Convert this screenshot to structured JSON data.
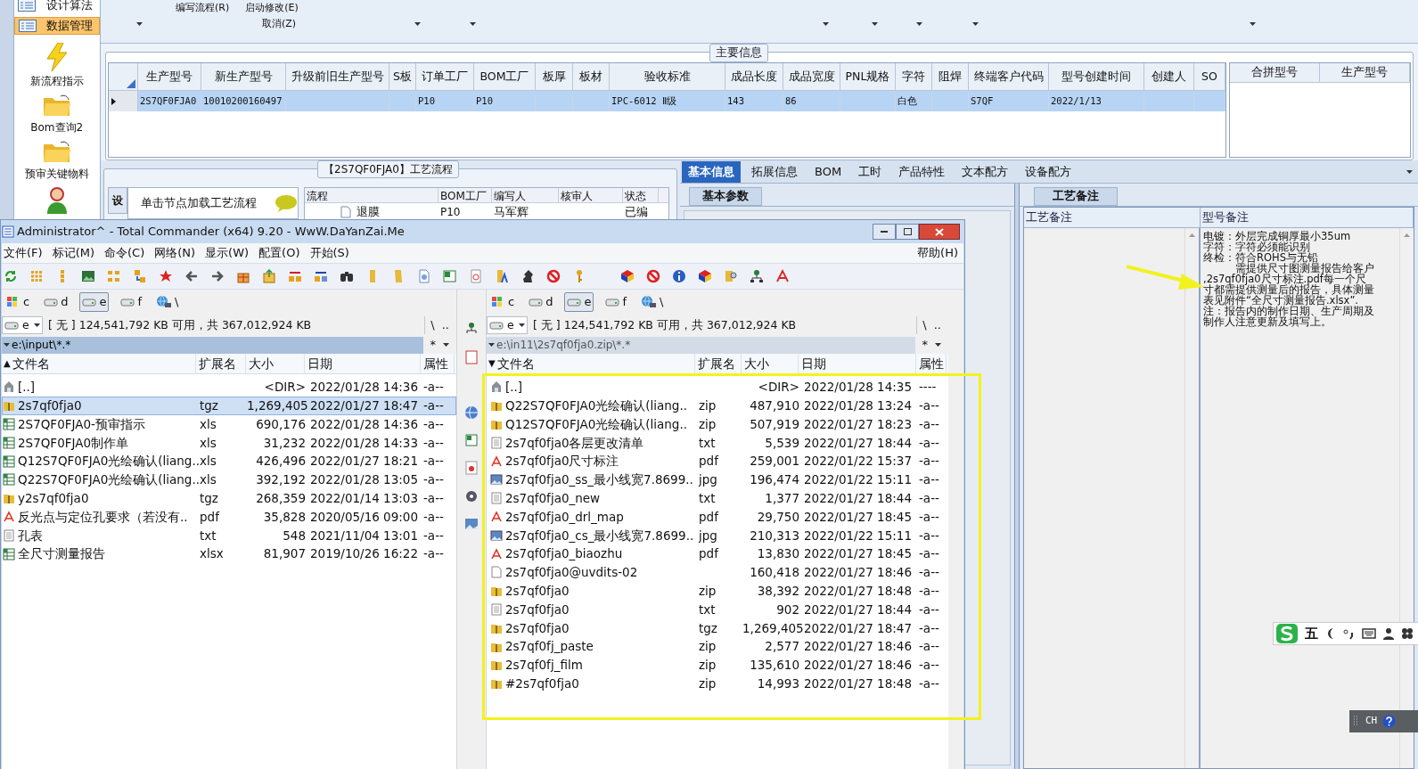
{
  "sidebar": {
    "items": [
      {
        "kind": "row",
        "label": "设计算法",
        "selected": false
      },
      {
        "kind": "row",
        "label": "数据管理",
        "selected": true
      },
      {
        "kind": "tile",
        "label": "新流程指示",
        "selected": false
      },
      {
        "kind": "tile",
        "label": "Bom查询2",
        "selected": false
      },
      {
        "kind": "tile",
        "label": "预审关键物料",
        "selected": false
      },
      {
        "kind": "tile",
        "selected": false
      }
    ]
  },
  "toolbar": {
    "commands": [
      "编写流程(R)",
      "启动修改(E)",
      "取消(Z)"
    ]
  },
  "main_info": {
    "title": "主要信息",
    "row_selected": true,
    "columns": [
      {
        "label": "生产型号",
        "value": "2S7QF0FJA0"
      },
      {
        "label": "新生产型号",
        "value": "10010200160497"
      },
      {
        "label": "升级前旧生产型号"
      },
      {
        "label": "S板"
      },
      {
        "label": "订单工厂",
        "value": "P10"
      },
      {
        "label": "BOM工厂",
        "value": "P10"
      },
      {
        "label": "板厚"
      },
      {
        "label": "板材"
      },
      {
        "label": "验收标准",
        "value": "IPC-6012 Ⅱ级"
      },
      {
        "label": "成品长度",
        "value": "143"
      },
      {
        "label": "成品宽度",
        "value": "86"
      },
      {
        "label": "PNL规格"
      },
      {
        "label": "字符",
        "value": "白色"
      },
      {
        "label": "阻焊"
      },
      {
        "label": "终端客户代码",
        "value": "S7QF"
      },
      {
        "label": "型号创建时间",
        "value": "2022/1/13"
      },
      {
        "label": "创建人"
      },
      {
        "label": "SO"
      }
    ],
    "merge_columns": [
      "合拼型号",
      "生产型号"
    ]
  },
  "process": {
    "title": "【2S7QF0FJA0】工艺流程",
    "side_tab": "设",
    "hint": "单击节点加载工艺流程",
    "columns": [
      "流程",
      "BOM工厂",
      "编写人",
      "核审人",
      "状态"
    ],
    "row": {
      "flow": "退膜",
      "bom": "P10",
      "writer": "马军辉",
      "status": "已编"
    }
  },
  "detail": {
    "tabs": [
      {
        "label": "基本信息",
        "selected": true
      },
      {
        "label": "拓展信息",
        "selected": false
      },
      {
        "label": "BOM",
        "selected": false
      },
      {
        "label": "工时",
        "selected": false
      },
      {
        "label": "产品特性",
        "selected": false
      },
      {
        "label": "文本配方",
        "selected": false
      },
      {
        "label": "设备配方",
        "selected": false
      }
    ],
    "sub_tab": "基本参数",
    "notes_tab": "工艺备注",
    "notes_columns": [
      "工艺备注",
      "型号备注"
    ],
    "model_note": [
      "电镀：外层完成铜厚最小35um",
      "字符：字符必须能识别",
      "终检：符合ROHS与无铅",
      "　　　需提供尺寸图测量报告给客户",
      ",2s7qf0fja0尺寸标注.pdf每一个尺",
      "寸都需提供测量后的报告，具体测量",
      "表见附件“全尺寸测量报告.xlsx”.",
      "注：报告内的制作日期、生产周期及",
      "制作人注意更新及填写上。"
    ]
  },
  "ime": {
    "mode": "五"
  },
  "language_bar": {
    "label": "CH"
  },
  "commander": {
    "title": "Administrator^ - Total Commander (x64) 9.20 - WwW.DaYanZai.Me",
    "menu": [
      "文件(F)",
      "标记(M)",
      "命令(C)",
      "网络(N)",
      "显示(W)",
      "配置(O)",
      "开始(S)"
    ],
    "help": "帮助(H)",
    "panels": [
      {
        "active": true,
        "sort": "▲",
        "drive": "e",
        "free_space": "[ 无 ] 124,541,792 KB 可用，共 367,012,924 KB",
        "root": "\\",
        "parent": "..",
        "path": "e:\\input\\*.*",
        "filter": "*",
        "drives": [
          {
            "kind": "system",
            "label": "c",
            "selected": false
          },
          {
            "kind": "disk",
            "label": "d",
            "selected": false
          },
          {
            "kind": "disk",
            "label": "e",
            "selected": true
          },
          {
            "kind": "disk",
            "label": "f",
            "selected": false
          },
          {
            "kind": "network",
            "label": "\\",
            "selected": false
          }
        ],
        "columns": [
          "文件名",
          "扩展名",
          "大小",
          "日期",
          "属性"
        ],
        "files": [
          {
            "kind": "up",
            "name": "[..]",
            "size": "<DIR>",
            "date": "2022/01/28 14:36",
            "attr": "-a--",
            "selected": false
          },
          {
            "kind": "archive",
            "name": "2s7qf0fja0",
            "ext": "tgz",
            "size": "1,269,405",
            "date": "2022/01/27 18:47",
            "attr": "-a--",
            "selected": true
          },
          {
            "kind": "sheet",
            "name": "2S7QF0FJA0-预审指示",
            "ext": "xls",
            "size": "690,176",
            "date": "2022/01/28 14:36",
            "attr": "-a--",
            "selected": false
          },
          {
            "kind": "sheet",
            "name": "2S7QF0FJA0制作单",
            "ext": "xls",
            "size": "31,232",
            "date": "2022/01/28 14:33",
            "attr": "-a--",
            "selected": false
          },
          {
            "kind": "sheet",
            "name": "Q12S7QF0FJA0光绘确认(liang..",
            "ext": "xls",
            "size": "426,496",
            "date": "2022/01/27 18:21",
            "attr": "-a--",
            "selected": false
          },
          {
            "kind": "sheet",
            "name": "Q22S7QF0FJA0光绘确认(liang..",
            "ext": "xls",
            "size": "392,192",
            "date": "2022/01/28 13:05",
            "attr": "-a--",
            "selected": false
          },
          {
            "kind": "archive",
            "name": "y2s7qf0fja0",
            "ext": "tgz",
            "size": "268,359",
            "date": "2022/01/14 13:03",
            "attr": "-a--",
            "selected": false
          },
          {
            "kind": "pdf",
            "name": "反光点与定位孔要求（若没有..",
            "ext": "pdf",
            "size": "35,828",
            "date": "2020/05/16 09:00",
            "attr": "-a--",
            "selected": false
          },
          {
            "kind": "text",
            "name": "孔表",
            "ext": "txt",
            "size": "548",
            "date": "2021/11/04 13:01",
            "attr": "-a--",
            "selected": false
          },
          {
            "kind": "sheet",
            "name": "全尺寸测量报告",
            "ext": "xlsx",
            "size": "81,907",
            "date": "2019/10/26 16:22",
            "attr": "-a--",
            "selected": false
          }
        ]
      },
      {
        "active": false,
        "sort": "▼",
        "drive": "e",
        "free_space": "[ 无 ] 124,541,792 KB 可用，共 367,012,924 KB",
        "root": "\\",
        "parent": "..",
        "path": "e:\\in11\\2s7qf0fja0.zip\\*.*",
        "filter": "*",
        "drives": [
          {
            "kind": "system",
            "label": "c",
            "selected": false
          },
          {
            "kind": "disk",
            "label": "d",
            "selected": false
          },
          {
            "kind": "disk",
            "label": "e",
            "selected": true
          },
          {
            "kind": "disk",
            "label": "f",
            "selected": false
          },
          {
            "kind": "network",
            "label": "\\",
            "selected": false
          }
        ],
        "columns": [
          "文件名",
          "扩展名",
          "大小",
          "日期",
          "属性"
        ],
        "files": [
          {
            "kind": "up",
            "name": "[..]",
            "size": "<DIR>",
            "date": "2022/01/28 14:35",
            "attr": "----",
            "selected": false
          },
          {
            "kind": "archive",
            "name": "Q22S7QF0FJA0光绘确认(liang..",
            "ext": "zip",
            "size": "487,910",
            "date": "2022/01/28 13:24",
            "attr": "-a--",
            "selected": false
          },
          {
            "kind": "archive",
            "name": "Q12S7QF0FJA0光绘确认(liang..",
            "ext": "zip",
            "size": "507,919",
            "date": "2022/01/27 18:23",
            "attr": "-a--",
            "selected": false
          },
          {
            "kind": "text",
            "name": "2s7qf0fja0各层更改清单",
            "ext": "txt",
            "size": "5,539",
            "date": "2022/01/27 18:44",
            "attr": "-a--",
            "selected": false
          },
          {
            "kind": "pdf",
            "name": "2s7qf0fja0尺寸标注",
            "ext": "pdf",
            "size": "259,001",
            "date": "2022/01/22 15:37",
            "attr": "-a--",
            "selected": false
          },
          {
            "kind": "image",
            "name": "2s7qf0fja0_ss_最小线宽7.8699..",
            "ext": "jpg",
            "size": "196,474",
            "date": "2022/01/22 15:11",
            "attr": "-a--",
            "selected": false
          },
          {
            "kind": "text",
            "name": "2s7qf0fja0_new",
            "ext": "txt",
            "size": "1,377",
            "date": "2022/01/27 18:44",
            "attr": "-a--",
            "selected": false
          },
          {
            "kind": "pdf",
            "name": "2s7qf0fja0_drl_map",
            "ext": "pdf",
            "size": "29,750",
            "date": "2022/01/27 18:45",
            "attr": "-a--",
            "selected": false
          },
          {
            "kind": "image",
            "name": "2s7qf0fja0_cs_最小线宽7.8699..",
            "ext": "jpg",
            "size": "210,313",
            "date": "2022/01/22 15:11",
            "attr": "-a--",
            "selected": false
          },
          {
            "kind": "pdf",
            "name": "2s7qf0fja0_biaozhu",
            "ext": "pdf",
            "size": "13,830",
            "date": "2022/01/27 18:45",
            "attr": "-a--",
            "selected": false
          },
          {
            "kind": "file",
            "name": "2s7qf0fja0@uvdits-02",
            "size": "160,418",
            "date": "2022/01/27 18:46",
            "attr": "-a--",
            "selected": false
          },
          {
            "kind": "archive",
            "name": "2s7qf0fja0",
            "ext": "zip",
            "size": "38,392",
            "date": "2022/01/27 18:48",
            "attr": "-a--",
            "selected": false
          },
          {
            "kind": "text",
            "name": "2s7qf0fja0",
            "ext": "txt",
            "size": "902",
            "date": "2022/01/27 18:44",
            "attr": "-a--",
            "selected": false
          },
          {
            "kind": "archive",
            "name": "2s7qf0fja0",
            "ext": "tgz",
            "size": "1,269,405",
            "date": "2022/01/27 18:47",
            "attr": "-a--",
            "selected": false
          },
          {
            "kind": "archive",
            "name": "2s7qf0fj_paste",
            "ext": "zip",
            "size": "2,577",
            "date": "2022/01/27 18:46",
            "attr": "-a--",
            "selected": false
          },
          {
            "kind": "archive",
            "name": "2s7qf0fj_film",
            "ext": "zip",
            "size": "135,610",
            "date": "2022/01/27 18:46",
            "attr": "-a--",
            "selected": false
          },
          {
            "kind": "archive",
            "name": "#2s7qf0fja0",
            "ext": "zip",
            "size": "14,993",
            "date": "2022/01/27 18:48",
            "attr": "-a--",
            "selected": false
          }
        ]
      }
    ]
  }
}
